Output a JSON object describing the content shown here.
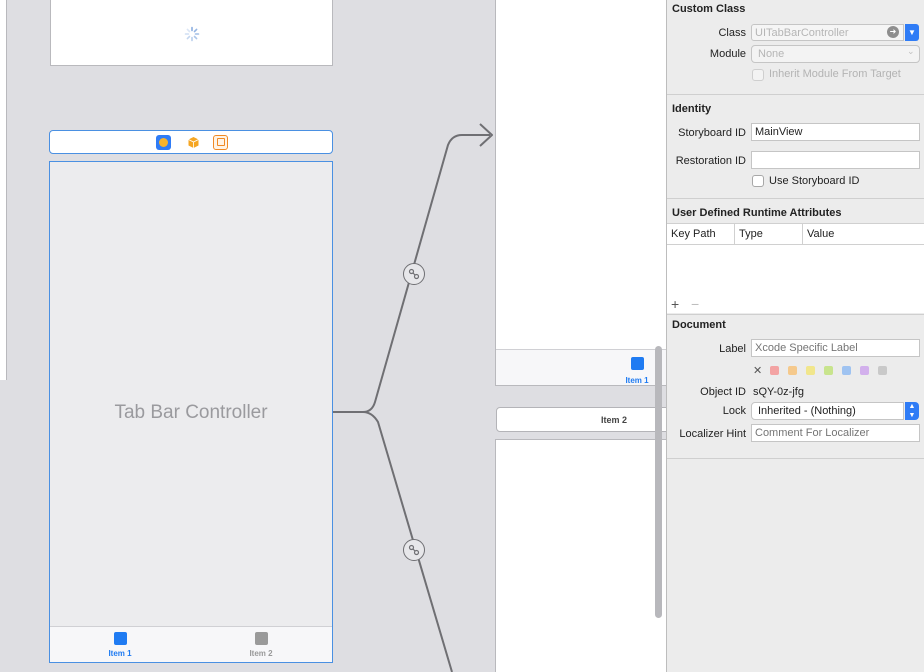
{
  "canvas": {
    "tab_bar_controller_title": "Tab Bar Controller",
    "tab_items": [
      {
        "label": "Item 1",
        "color": "#1f7bf2"
      },
      {
        "label": "Item 2",
        "color": "#9a9a9a"
      }
    ],
    "right_scene_item1_label": "Item 1",
    "right_scene_item2_header": "Item 2",
    "colors": {
      "selection": "#4a90e2",
      "segue": "#6f6f73"
    }
  },
  "inspector": {
    "custom_class": {
      "title": "Custom Class",
      "class_label": "Class",
      "class_value": "UITabBarController",
      "module_label": "Module",
      "module_value": "None",
      "inherit_label": "Inherit Module From Target"
    },
    "identity": {
      "title": "Identity",
      "storyboard_id_label": "Storyboard ID",
      "storyboard_id_value": "MainView",
      "restoration_id_label": "Restoration ID",
      "restoration_id_value": "",
      "use_storyboard_id_label": "Use Storyboard ID"
    },
    "runtime_attributes": {
      "title": "User Defined Runtime Attributes",
      "columns": [
        "Key Path",
        "Type",
        "Value"
      ],
      "add_symbol": "+",
      "remove_symbol": "−"
    },
    "document": {
      "title": "Document",
      "label_label": "Label",
      "label_placeholder": "Xcode Specific Label",
      "clear_symbol": "✕",
      "swatches": [
        "#f3a3a3",
        "#f5c98c",
        "#f1e68c",
        "#c8e48d",
        "#9fc3f1",
        "#d2b0ec",
        "#c9c9c9"
      ],
      "object_id_label": "Object ID",
      "object_id_value": "sQY-0z-jfg",
      "lock_label": "Lock",
      "lock_value": "Inherited - (Nothing)",
      "localizer_label": "Localizer Hint",
      "localizer_placeholder": "Comment For Localizer"
    }
  }
}
